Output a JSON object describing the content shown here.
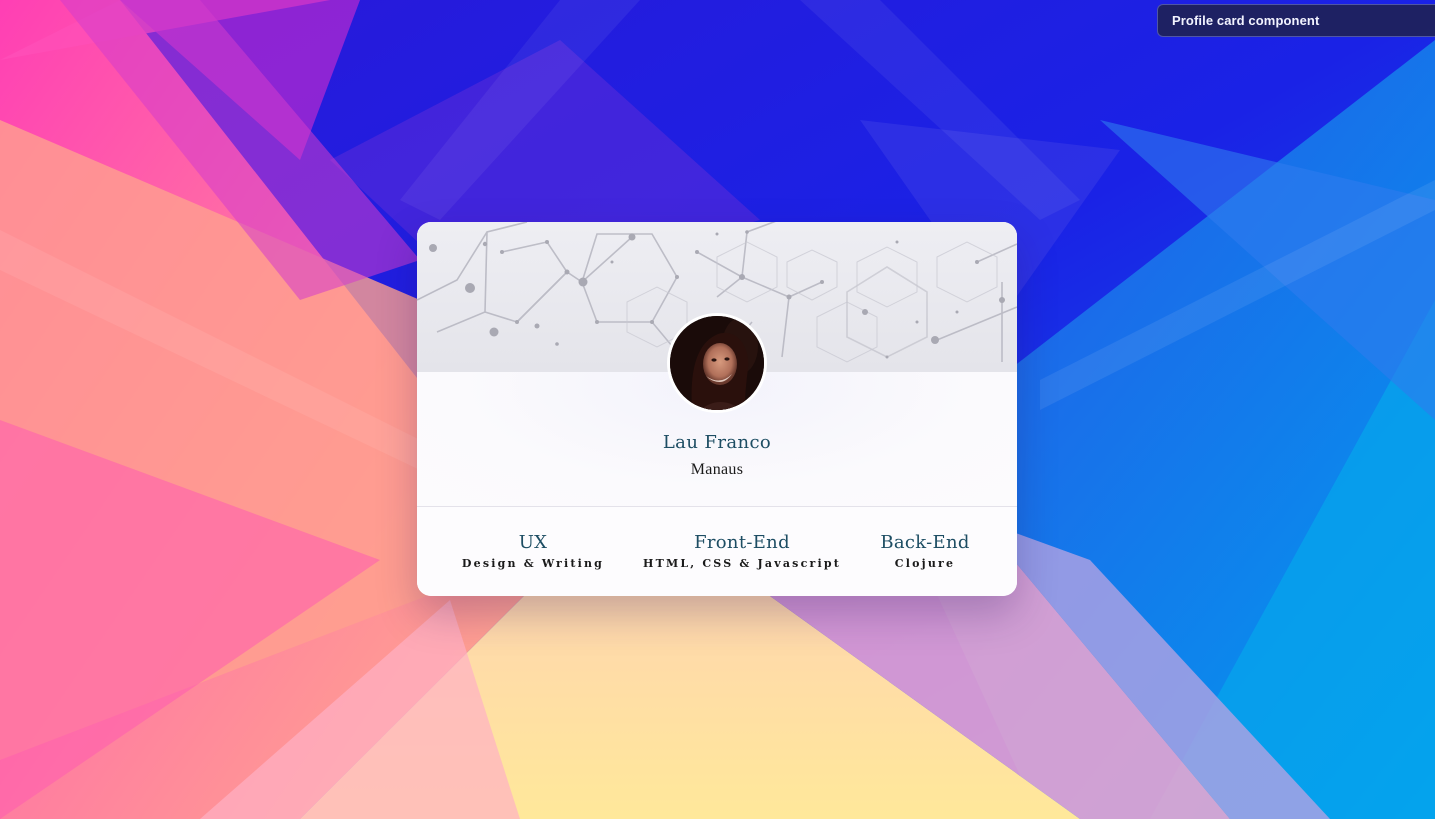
{
  "chip": {
    "label": "Profile card component"
  },
  "profile": {
    "name": "Lau Franco",
    "city": "Manaus",
    "avatar_icon": "person-photo"
  },
  "stats": [
    {
      "title": "UX",
      "subtitle": "Design & Writing"
    },
    {
      "title": "Front-End",
      "subtitle": "HTML, CSS & Javascript"
    },
    {
      "title": "Back-End",
      "subtitle": "Clojure"
    }
  ],
  "colors": {
    "accent_text": "#1d4d63",
    "body_text": "#1a1a1a",
    "chip_bg": "#1e2258"
  }
}
